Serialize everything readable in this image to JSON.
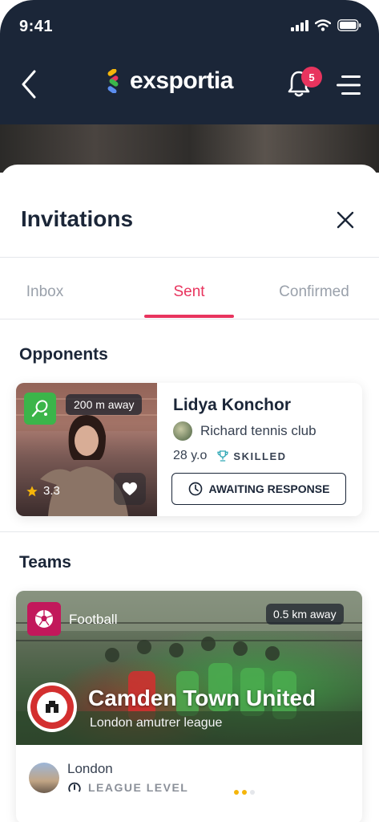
{
  "status_bar": {
    "time": "9:41"
  },
  "header": {
    "logo_text": "exsportia",
    "notification_count": "5"
  },
  "sheet": {
    "title": "Invitations",
    "tabs": [
      {
        "label": "Inbox",
        "active": false
      },
      {
        "label": "Sent",
        "active": true
      },
      {
        "label": "Confirmed",
        "active": false
      }
    ]
  },
  "opponents": {
    "section_title": "Opponents",
    "card": {
      "distance": "200 m away",
      "rating": "3.3",
      "name": "Lidya Konchor",
      "club": "Richard tennis club",
      "age": "28 y.o",
      "skill": "SKILLED",
      "status": "AWAITING RESPONSE"
    }
  },
  "teams": {
    "section_title": "Teams",
    "card": {
      "sport": "Football",
      "distance": "0.5 km away",
      "name": "Camden Town United",
      "league": "London amutrer league",
      "city": "London",
      "level_label": "LEAGUE LEVEL",
      "level_value": 2,
      "level_max": 3
    }
  },
  "colors": {
    "accent": "#e8345e",
    "navy": "#1b2638",
    "tennis_green": "#3bb54a",
    "football_magenta": "#c2185b",
    "gold": "#f5b50a"
  },
  "icons": [
    "back-arrow-icon",
    "bell-icon",
    "menu-icon",
    "close-icon",
    "tennis-icon",
    "star-icon",
    "heart-icon",
    "clock-icon",
    "trophy-icon",
    "football-icon",
    "gauge-icon"
  ]
}
